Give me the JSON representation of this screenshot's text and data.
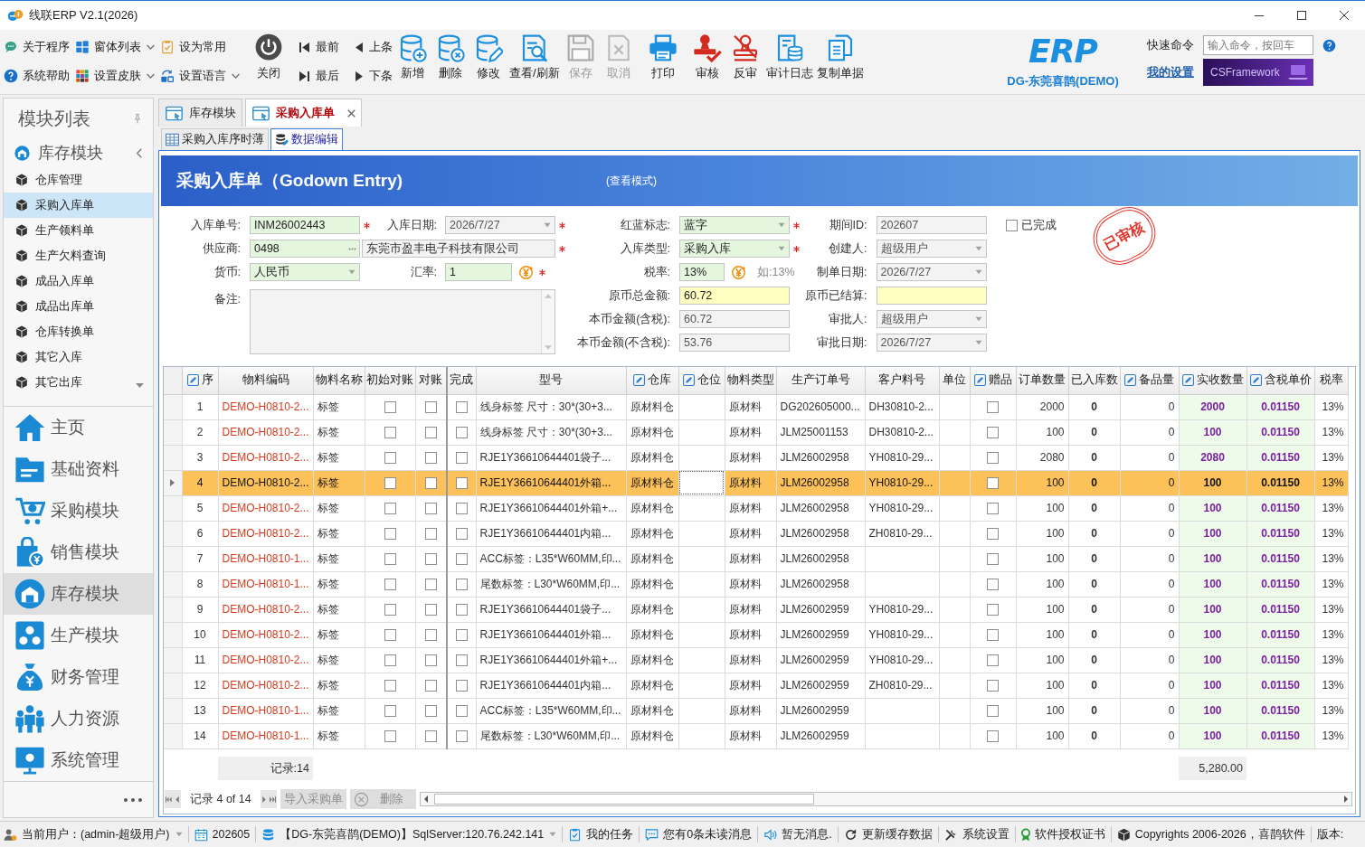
{
  "window": {
    "title": "线联ERP V2.1(2026)"
  },
  "ribbon": {
    "quick_items": [
      {
        "label": "关于程序",
        "dropdown": false
      },
      {
        "label": "窗体列表",
        "dropdown": true
      },
      {
        "label": "设为常用",
        "dropdown": false
      },
      {
        "label": "系统帮助",
        "dropdown": false
      },
      {
        "label": "设置皮肤",
        "dropdown": true
      },
      {
        "label": "设置语言",
        "dropdown": true
      }
    ],
    "close_button": "关闭",
    "navigation": [
      "最前",
      "上条",
      "最后",
      "下条"
    ],
    "action_groups": [
      [
        {
          "label": "新增",
          "disabled": false
        },
        {
          "label": "删除",
          "disabled": false
        },
        {
          "label": "修改",
          "disabled": false
        },
        {
          "label": "查看/刷新",
          "disabled": false
        },
        {
          "label": "保存",
          "disabled": true
        },
        {
          "label": "取消",
          "disabled": true
        }
      ],
      [
        {
          "label": "打印",
          "disabled": false
        }
      ],
      [
        {
          "label": "审核",
          "disabled": false
        },
        {
          "label": "反审",
          "disabled": false
        },
        {
          "label": "审计日志",
          "disabled": false
        },
        {
          "label": "复制单据",
          "disabled": false
        }
      ]
    ]
  },
  "brand": {
    "logo": "ERP",
    "company": "DG-东莞喜鹊(DEMO)"
  },
  "quick_command": {
    "label": "快速命令",
    "placeholder": "输入命令，按回车",
    "settings_link": "我的设置",
    "banner": "CSFramework"
  },
  "sidebar": {
    "title": "模块列表",
    "group": {
      "label": "库存模块",
      "expanded": true,
      "items": [
        {
          "label": "仓库管理",
          "selected": false
        },
        {
          "label": "采购入库单",
          "selected": true
        },
        {
          "label": "生产领料单",
          "selected": false
        },
        {
          "label": "生产欠料查询",
          "selected": false
        },
        {
          "label": "成品入库单",
          "selected": false
        },
        {
          "label": "成品出库单",
          "selected": false
        },
        {
          "label": "仓库转换单",
          "selected": false
        },
        {
          "label": "其它入库",
          "selected": false
        },
        {
          "label": "其它出库",
          "selected": false
        }
      ]
    },
    "modules": [
      {
        "label": "主页",
        "selected": false
      },
      {
        "label": "基础资料",
        "selected": false
      },
      {
        "label": "采购模块",
        "selected": false
      },
      {
        "label": "销售模块",
        "selected": false
      },
      {
        "label": "库存模块",
        "selected": true
      },
      {
        "label": "生产模块",
        "selected": false
      },
      {
        "label": "财务管理",
        "selected": false
      },
      {
        "label": "人力资源",
        "selected": false
      },
      {
        "label": "系统管理",
        "selected": false
      }
    ]
  },
  "tabs": [
    {
      "label": "库存模块",
      "selected": false,
      "closable": false
    },
    {
      "label": "采购入库单",
      "selected": true,
      "closable": true
    }
  ],
  "subtabs": [
    {
      "label": "采购入库序时薄",
      "selected": false
    },
    {
      "label": "数据编辑",
      "selected": true
    }
  ],
  "form": {
    "title": "采购入库单（Godown Entry)",
    "mode": "(查看模式)",
    "left_rows": [
      [
        {
          "label": "入库单号:",
          "value": "INM26002443",
          "kind": "text",
          "readonly": false,
          "highlighted": false,
          "required": true
        },
        {
          "label": "入库日期:",
          "value": "2026/7/27",
          "kind": "date",
          "readonly": true,
          "highlighted": false,
          "required": true
        }
      ],
      [
        {
          "label": "供应商:",
          "value": "0498",
          "kind": "lookup",
          "readonly": false,
          "highlighted": false,
          "required": true,
          "display": "东莞市盈丰电子科技有限公司"
        }
      ],
      [
        {
          "label": "货币:",
          "value": "人民币",
          "kind": "combo",
          "readonly": false,
          "highlighted": false,
          "required": false
        },
        {
          "label": "汇率:",
          "value": "1",
          "kind": "text",
          "readonly": false,
          "highlighted": false,
          "required": true,
          "currency_button": true
        }
      ],
      [
        {
          "label": "备注:",
          "kind": "memo",
          "readonly": true,
          "highlighted": false,
          "required": false
        }
      ]
    ],
    "middle_fields": [
      {
        "label": "红蓝标志:",
        "value": "蓝字",
        "kind": "combo",
        "readonly": false,
        "highlighted": false,
        "required": true
      },
      {
        "label": "入库类型:",
        "value": "采购入库",
        "kind": "combo",
        "readonly": false,
        "highlighted": false,
        "required": true
      },
      {
        "label": "税率:",
        "value": "13%",
        "kind": "text",
        "readonly": false,
        "highlighted": false,
        "required": false,
        "currency_button": true,
        "hint": "如:13%"
      },
      {
        "label": "原币总金额:",
        "value": "60.72",
        "kind": "text",
        "readonly": false,
        "highlighted": true,
        "required": false
      },
      {
        "label": "本币金额(含税):",
        "value": "60.72",
        "kind": "text",
        "readonly": true,
        "highlighted": false,
        "required": false
      },
      {
        "label": "本币金额(不含税):",
        "value": "53.76",
        "kind": "text",
        "readonly": true,
        "highlighted": false,
        "required": false
      }
    ],
    "right_fields": [
      {
        "label": "期间ID:",
        "value": "202607",
        "kind": "text",
        "readonly": true,
        "highlighted": false,
        "required": false
      },
      {
        "label": "创建人:",
        "value": "超级用户",
        "kind": "combo",
        "readonly": true,
        "highlighted": false,
        "required": false
      },
      {
        "label": "制单日期:",
        "value": "2026/7/27",
        "kind": "date",
        "readonly": true,
        "highlighted": false,
        "required": false
      },
      {
        "label": "原币已结算:",
        "kind": "text",
        "readonly": false,
        "highlighted": true,
        "required": false
      },
      {
        "label": "审批人:",
        "value": "超级用户",
        "kind": "combo",
        "readonly": true,
        "highlighted": false,
        "required": false
      },
      {
        "label": "审批日期:",
        "value": "2026/7/27",
        "kind": "date",
        "readonly": true,
        "highlighted": false,
        "required": false
      }
    ],
    "completed": {
      "label": "已完成",
      "checked": false
    },
    "stamp": "已审核"
  },
  "grid": {
    "columns": [
      {
        "label": "序",
        "editable": true
      },
      {
        "label": "物料编码",
        "editable": false
      },
      {
        "label": "物料名称",
        "editable": false
      },
      {
        "label": "初始对账",
        "editable": false
      },
      {
        "label": "对账",
        "editable": false
      },
      {
        "label": "完成",
        "editable": false
      },
      {
        "label": "型号",
        "editable": false
      },
      {
        "label": "仓库",
        "editable": true
      },
      {
        "label": "仓位",
        "editable": true
      },
      {
        "label": "物料类型",
        "editable": false
      },
      {
        "label": "生产订单号",
        "editable": false
      },
      {
        "label": "客户料号",
        "editable": false
      },
      {
        "label": "单位",
        "editable": false
      },
      {
        "label": "赠品",
        "editable": true
      },
      {
        "label": "订单数量",
        "editable": false
      },
      {
        "label": "已入库数",
        "editable": false
      },
      {
        "label": "备品量",
        "editable": true
      },
      {
        "label": "实收数量",
        "editable": true
      },
      {
        "label": "含税单价",
        "editable": true
      },
      {
        "label": "税率",
        "editable": false
      }
    ],
    "rows": [
      {
        "seq": "1",
        "material_code": "DEMO-H0810-2...",
        "material_name": "标签",
        "initial_reconciled": false,
        "reconciled": false,
        "completed": false,
        "model": "线身标签 尺寸：30*(30+3...",
        "warehouse": "原材料仓",
        "material_type": "原材料",
        "production_order": "DG202605000...",
        "customer_part": "DH30810-2...",
        "gift": false,
        "order_qty": "2000",
        "received_before": "0",
        "spare_qty": "0",
        "received_qty": "2000",
        "unit_price": "0.01150",
        "tax_rate": "13%",
        "selected": false
      },
      {
        "seq": "2",
        "material_code": "DEMO-H0810-2...",
        "material_name": "标签",
        "initial_reconciled": false,
        "reconciled": false,
        "completed": false,
        "model": "线身标签 尺寸：30*(30+3...",
        "warehouse": "原材料仓",
        "material_type": "原材料",
        "production_order": "JLM25001153",
        "customer_part": "DH30810-2...",
        "gift": false,
        "order_qty": "100",
        "received_before": "0",
        "spare_qty": "0",
        "received_qty": "100",
        "unit_price": "0.01150",
        "tax_rate": "13%",
        "selected": false
      },
      {
        "seq": "3",
        "material_code": "DEMO-H0810-2...",
        "material_name": "标签",
        "initial_reconciled": false,
        "reconciled": false,
        "completed": false,
        "model": "RJE1Y36610644401袋子...",
        "warehouse": "原材料仓",
        "material_type": "原材料",
        "production_order": "JLM26002958",
        "customer_part": "YH0810-29...",
        "gift": false,
        "order_qty": "2080",
        "received_before": "0",
        "spare_qty": "0",
        "received_qty": "2080",
        "unit_price": "0.01150",
        "tax_rate": "13%",
        "selected": false
      },
      {
        "seq": "4",
        "material_code": "DEMO-H0810-2...",
        "material_name": "标签",
        "initial_reconciled": false,
        "reconciled": false,
        "completed": false,
        "model": "RJE1Y36610644401外箱...",
        "warehouse": "原材料仓",
        "material_type": "原材料",
        "production_order": "JLM26002958",
        "customer_part": "YH0810-29...",
        "gift": false,
        "order_qty": "100",
        "received_before": "0",
        "spare_qty": "0",
        "received_qty": "100",
        "unit_price": "0.01150",
        "tax_rate": "13%",
        "selected": true
      },
      {
        "seq": "5",
        "material_code": "DEMO-H0810-2...",
        "material_name": "标签",
        "initial_reconciled": false,
        "reconciled": false,
        "completed": false,
        "model": "RJE1Y36610644401外箱+...",
        "warehouse": "原材料仓",
        "material_type": "原材料",
        "production_order": "JLM26002958",
        "customer_part": "YH0810-29...",
        "gift": false,
        "order_qty": "100",
        "received_before": "0",
        "spare_qty": "0",
        "received_qty": "100",
        "unit_price": "0.01150",
        "tax_rate": "13%",
        "selected": false
      },
      {
        "seq": "6",
        "material_code": "DEMO-H0810-2...",
        "material_name": "标签",
        "initial_reconciled": false,
        "reconciled": false,
        "completed": false,
        "model": "RJE1Y36610644401内箱...",
        "warehouse": "原材料仓",
        "material_type": "原材料",
        "production_order": "JLM26002958",
        "customer_part": "ZH0810-29...",
        "gift": false,
        "order_qty": "100",
        "received_before": "0",
        "spare_qty": "0",
        "received_qty": "100",
        "unit_price": "0.01150",
        "tax_rate": "13%",
        "selected": false
      },
      {
        "seq": "7",
        "material_code": "DEMO-H0810-1...",
        "material_name": "标签",
        "initial_reconciled": false,
        "reconciled": false,
        "completed": false,
        "model": "ACC标签：L35*W60MM,印...",
        "warehouse": "原材料仓",
        "material_type": "原材料",
        "production_order": "JLM26002958",
        "gift": false,
        "order_qty": "100",
        "received_before": "0",
        "spare_qty": "0",
        "received_qty": "100",
        "unit_price": "0.01150",
        "tax_rate": "13%",
        "selected": false
      },
      {
        "seq": "8",
        "material_code": "DEMO-H0810-1...",
        "material_name": "标签",
        "initial_reconciled": false,
        "reconciled": false,
        "completed": false,
        "model": "尾数标签：L30*W60MM,印...",
        "warehouse": "原材料仓",
        "material_type": "原材料",
        "production_order": "JLM26002958",
        "gift": false,
        "order_qty": "100",
        "received_before": "0",
        "spare_qty": "0",
        "received_qty": "100",
        "unit_price": "0.01150",
        "tax_rate": "13%",
        "selected": false
      },
      {
        "seq": "9",
        "material_code": "DEMO-H0810-2...",
        "material_name": "标签",
        "initial_reconciled": false,
        "reconciled": false,
        "completed": false,
        "model": "RJE1Y36610644401袋子...",
        "warehouse": "原材料仓",
        "material_type": "原材料",
        "production_order": "JLM26002959",
        "customer_part": "YH0810-29...",
        "gift": false,
        "order_qty": "100",
        "received_before": "0",
        "spare_qty": "0",
        "received_qty": "100",
        "unit_price": "0.01150",
        "tax_rate": "13%",
        "selected": false
      },
      {
        "seq": "10",
        "material_code": "DEMO-H0810-2...",
        "material_name": "标签",
        "initial_reconciled": false,
        "reconciled": false,
        "completed": false,
        "model": "RJE1Y36610644401外箱...",
        "warehouse": "原材料仓",
        "material_type": "原材料",
        "production_order": "JLM26002959",
        "customer_part": "YH0810-29...",
        "gift": false,
        "order_qty": "100",
        "received_before": "0",
        "spare_qty": "0",
        "received_qty": "100",
        "unit_price": "0.01150",
        "tax_rate": "13%",
        "selected": false
      },
      {
        "seq": "11",
        "material_code": "DEMO-H0810-2...",
        "material_name": "标签",
        "initial_reconciled": false,
        "reconciled": false,
        "completed": false,
        "model": "RJE1Y36610644401外箱+...",
        "warehouse": "原材料仓",
        "material_type": "原材料",
        "production_order": "JLM26002959",
        "customer_part": "YH0810-29...",
        "gift": false,
        "order_qty": "100",
        "received_before": "0",
        "spare_qty": "0",
        "received_qty": "100",
        "unit_price": "0.01150",
        "tax_rate": "13%",
        "selected": false
      },
      {
        "seq": "12",
        "material_code": "DEMO-H0810-2...",
        "material_name": "标签",
        "initial_reconciled": false,
        "reconciled": false,
        "completed": false,
        "model": "RJE1Y36610644401内箱...",
        "warehouse": "原材料仓",
        "material_type": "原材料",
        "production_order": "JLM26002959",
        "customer_part": "ZH0810-29...",
        "gift": false,
        "order_qty": "100",
        "received_before": "0",
        "spare_qty": "0",
        "received_qty": "100",
        "unit_price": "0.01150",
        "tax_rate": "13%",
        "selected": false
      },
      {
        "seq": "13",
        "material_code": "DEMO-H0810-1...",
        "material_name": "标签",
        "initial_reconciled": false,
        "reconciled": false,
        "completed": false,
        "model": "ACC标签：L35*W60MM,印...",
        "warehouse": "原材料仓",
        "material_type": "原材料",
        "production_order": "JLM26002959",
        "gift": false,
        "order_qty": "100",
        "received_before": "0",
        "spare_qty": "0",
        "received_qty": "100",
        "unit_price": "0.01150",
        "tax_rate": "13%",
        "selected": false
      },
      {
        "seq": "14",
        "material_code": "DEMO-H0810-1...",
        "material_name": "标签",
        "initial_reconciled": false,
        "reconciled": false,
        "completed": false,
        "model": "尾数标签：L30*W60MM,印...",
        "warehouse": "原材料仓",
        "material_type": "原材料",
        "production_order": "JLM26002959",
        "gift": false,
        "order_qty": "100",
        "received_before": "0",
        "spare_qty": "0",
        "received_qty": "100",
        "unit_price": "0.01150",
        "tax_rate": "13%",
        "selected": false
      }
    ],
    "summary": {
      "record_count": "记录:14",
      "received_total": "5,280.00"
    },
    "navigator": {
      "record": "记录 4 of 14",
      "buttons": [
        {
          "label": "导入采购单",
          "disabled": true
        },
        {
          "label": "删除",
          "disabled": true
        }
      ]
    }
  },
  "status_bar": {
    "items": [
      {
        "text": "当前用户：(admin-超级用户)",
        "dropdown": true
      },
      {
        "text": "202605",
        "dropdown": false
      },
      {
        "text": "【DG-东莞喜鹊(DEMO)】SqlServer:120.76.242.141",
        "dropdown": true
      },
      {
        "text": "我的任务",
        "dropdown": false
      },
      {
        "text": "您有0条未读消息",
        "dropdown": false
      },
      {
        "text": "暂无消息.",
        "dropdown": false
      },
      {
        "text": "更新缓存数据",
        "dropdown": false
      },
      {
        "text": "系统设置",
        "dropdown": false
      },
      {
        "text": "软件授权证书",
        "dropdown": false
      },
      {
        "text": "Copyrights 2006-2026，喜鹊软件",
        "dropdown": false
      },
      {
        "text": "版本:",
        "dropdown": false
      }
    ]
  }
}
